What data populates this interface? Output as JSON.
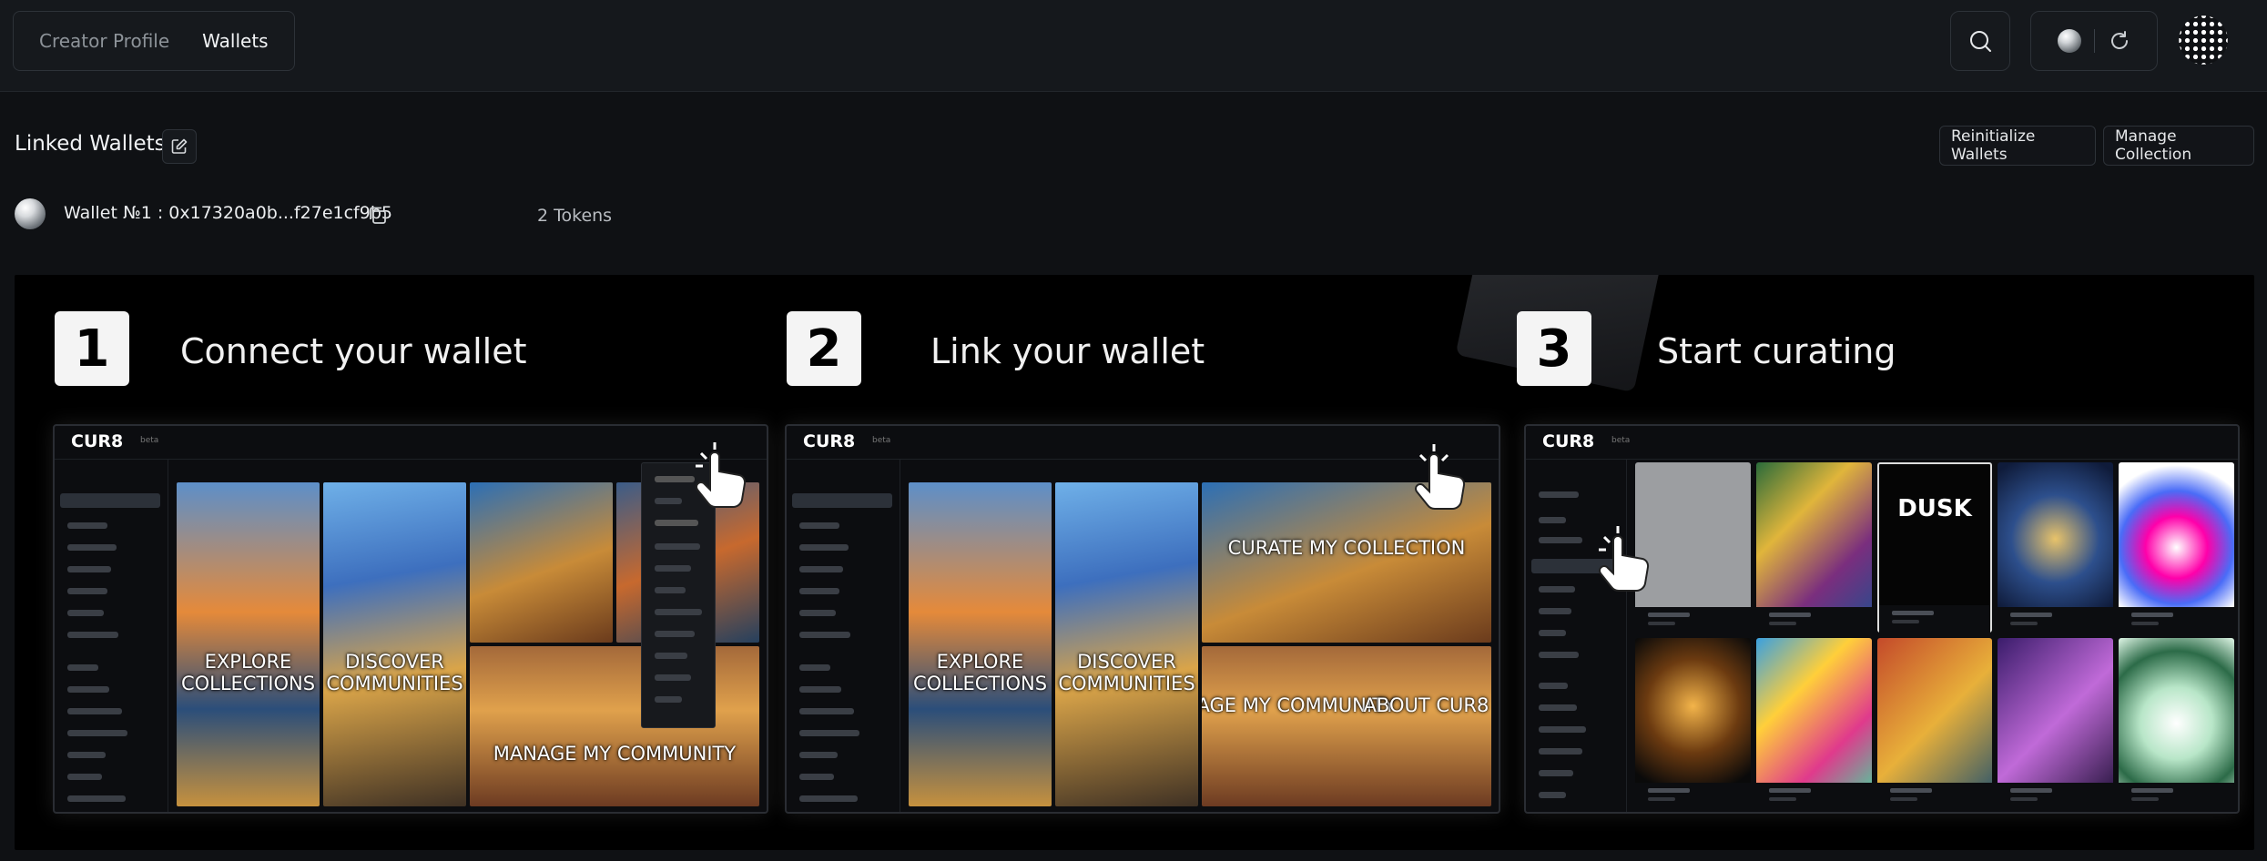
{
  "topbar": {
    "tabs": [
      {
        "label": "Creator Profile",
        "active": false
      },
      {
        "label": "Wallets",
        "active": true
      }
    ],
    "icons": [
      "search-icon",
      "theme-orb-icon",
      "refresh-icon",
      "dotted-avatar-icon"
    ]
  },
  "wallets": {
    "title": "Linked Wallets",
    "reinitialize_label": "Reinitialize Wallets",
    "manage_label": "Manage Collection",
    "items": [
      {
        "label": "Wallet №1 : 0x17320a0b...f27e1cf9b5",
        "tokens": "2 Tokens"
      }
    ]
  },
  "banner": {
    "steps": [
      {
        "number": "1",
        "title": "Connect your wallet"
      },
      {
        "number": "2",
        "title": "Link your wallet"
      },
      {
        "number": "3",
        "title": "Start curating"
      }
    ],
    "app_logo": "CUR8",
    "app_beta": "beta",
    "tiles": [
      "EXPLORE COLLECTIONS",
      "DISCOVER COMMUNITIES",
      "CURATE MY COLLECTION",
      "MANAGE MY COMMUNITY",
      "ABOUT CUR8"
    ],
    "nft_featured": "DUSK"
  },
  "colors": {
    "background": "#0f1114",
    "topbar": "#15181c",
    "border": "#2d3238",
    "banner": "#000000"
  }
}
